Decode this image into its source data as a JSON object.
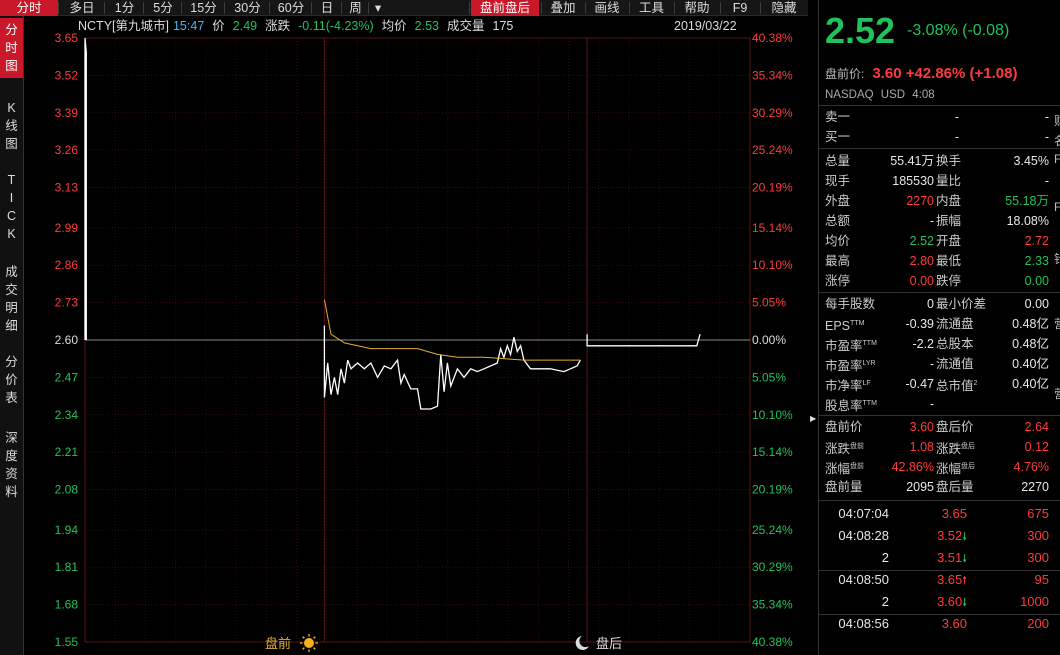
{
  "toolbar": {
    "tabs": [
      {
        "label": "分时",
        "active": true
      },
      {
        "label": "多日"
      },
      {
        "label": "1分"
      },
      {
        "label": "5分"
      },
      {
        "label": "15分"
      },
      {
        "label": "30分"
      },
      {
        "label": "60分"
      },
      {
        "label": "日"
      },
      {
        "label": "周"
      },
      {
        "label": "▾"
      }
    ],
    "right_tabs": [
      {
        "label": "盘前盘后",
        "active": true
      },
      {
        "label": "叠加"
      },
      {
        "label": "画线"
      },
      {
        "label": "工具"
      },
      {
        "label": "帮助"
      },
      {
        "label": "F9"
      },
      {
        "label": "隐藏"
      }
    ]
  },
  "left_tabs": [
    {
      "label": "分时图",
      "active": true
    },
    {
      "label": "K线图"
    },
    {
      "label": "TICK"
    },
    {
      "label": "成交明细"
    },
    {
      "label": "分价表"
    },
    {
      "label": "深度资料"
    }
  ],
  "header": {
    "symbol": "NCTY[第九城市]",
    "time": "15:47",
    "price_label": "价",
    "price": "2.49",
    "change_label": "涨跌",
    "change": "-0.11(-4.23%)",
    "avg_label": "均价",
    "avg": "2.53",
    "volume_label": "成交量",
    "volume": "175",
    "date": "2019/03/22"
  },
  "chart_data": {
    "type": "line",
    "y_left_ticks": [
      "3.65",
      "3.52",
      "3.39",
      "3.26",
      "3.13",
      "2.99",
      "2.86",
      "2.73",
      "2.60",
      "2.47",
      "2.34",
      "2.21",
      "2.08",
      "1.94",
      "1.81",
      "1.68",
      "1.55"
    ],
    "y_right_ticks": [
      "40.38%",
      "35.34%",
      "30.29%",
      "25.24%",
      "20.19%",
      "15.14%",
      "10.10%",
      "5.05%",
      "0.00%",
      "5.05%",
      "10.10%",
      "15.14%",
      "20.19%",
      "25.24%",
      "30.29%",
      "35.34%",
      "40.38%"
    ],
    "prev_close": 2.6,
    "ylim": [
      1.55,
      3.65
    ],
    "x_range": [
      0,
      1
    ],
    "session_labels": {
      "pre": "盘前",
      "post": "盘后"
    },
    "price_series": [
      [
        0.0,
        2.6
      ],
      [
        0.0,
        3.65
      ],
      [
        0.002,
        3.6
      ],
      [
        0.002,
        2.6
      ],
      [
        0.36,
        2.65
      ],
      [
        0.36,
        2.4
      ],
      [
        0.365,
        2.52
      ],
      [
        0.37,
        2.41
      ],
      [
        0.375,
        2.47
      ],
      [
        0.38,
        2.41
      ],
      [
        0.385,
        2.5
      ],
      [
        0.39,
        2.45
      ],
      [
        0.395,
        2.53
      ],
      [
        0.4,
        2.5
      ],
      [
        0.41,
        2.52
      ],
      [
        0.42,
        2.5
      ],
      [
        0.43,
        2.52
      ],
      [
        0.44,
        2.47
      ],
      [
        0.45,
        2.51
      ],
      [
        0.46,
        2.5
      ],
      [
        0.47,
        2.53
      ],
      [
        0.475,
        2.45
      ],
      [
        0.48,
        2.48
      ],
      [
        0.49,
        2.43
      ],
      [
        0.5,
        2.43
      ],
      [
        0.505,
        2.36
      ],
      [
        0.52,
        2.36
      ],
      [
        0.53,
        2.37
      ],
      [
        0.535,
        2.55
      ],
      [
        0.54,
        2.42
      ],
      [
        0.545,
        2.52
      ],
      [
        0.55,
        2.44
      ],
      [
        0.56,
        2.5
      ],
      [
        0.57,
        2.47
      ],
      [
        0.58,
        2.5
      ],
      [
        0.59,
        2.49
      ],
      [
        0.6,
        2.5
      ],
      [
        0.61,
        2.51
      ],
      [
        0.62,
        2.52
      ],
      [
        0.625,
        2.57
      ],
      [
        0.63,
        2.54
      ],
      [
        0.635,
        2.58
      ],
      [
        0.64,
        2.55
      ],
      [
        0.645,
        2.61
      ],
      [
        0.65,
        2.56
      ],
      [
        0.655,
        2.58
      ],
      [
        0.66,
        2.53
      ],
      [
        0.67,
        2.5
      ],
      [
        0.7,
        2.5
      ],
      [
        0.72,
        2.49
      ],
      [
        0.73,
        2.5
      ],
      [
        0.74,
        2.51
      ],
      [
        0.745,
        2.53
      ],
      [
        0.755,
        2.62
      ],
      [
        0.755,
        2.58
      ],
      [
        0.92,
        2.58
      ],
      [
        0.925,
        2.62
      ]
    ],
    "avg_series": [
      [
        0.36,
        2.74
      ],
      [
        0.37,
        2.62
      ],
      [
        0.39,
        2.59
      ],
      [
        0.43,
        2.57
      ],
      [
        0.5,
        2.57
      ],
      [
        0.53,
        2.55
      ],
      [
        0.56,
        2.54
      ],
      [
        0.6,
        2.54
      ],
      [
        0.66,
        2.53
      ],
      [
        0.7,
        2.53
      ],
      [
        0.745,
        2.53
      ]
    ]
  },
  "quote": {
    "price": "2.52",
    "change": "-3.08% (-0.08)",
    "pre_label": "盘前价:",
    "pre_value": "3.60 +42.86% (+1.08)",
    "exchange": "NASDAQ",
    "currency": "USD",
    "time": "4:08",
    "bidask": [
      {
        "label": "卖一",
        "v1": "-",
        "v2": "-"
      },
      {
        "label": "买一",
        "v1": "-",
        "v2": "-"
      }
    ],
    "stats": [
      {
        "l1": "总量",
        "v1": "55.41万",
        "c1": "w",
        "l2": "换手",
        "v2": "3.45%",
        "c2": "w"
      },
      {
        "l1": "现手",
        "v1": "185530",
        "c1": "w",
        "l2": "量比",
        "v2": "-",
        "c2": "w"
      },
      {
        "l1": "外盘",
        "v1": "2270",
        "c1": "r",
        "l2": "内盘",
        "v2": "55.18万",
        "c2": "g"
      },
      {
        "l1": "总额",
        "v1": "-",
        "c1": "w",
        "l2": "振幅",
        "v2": "18.08%",
        "c2": "w"
      },
      {
        "l1": "均价",
        "v1": "2.52",
        "c1": "g",
        "l2": "开盘",
        "v2": "2.72",
        "c2": "r"
      },
      {
        "l1": "最高",
        "v1": "2.80",
        "c1": "r",
        "l2": "最低",
        "v2": "2.33",
        "c2": "g"
      },
      {
        "l1": "涨停",
        "v1": "0.00",
        "c1": "r",
        "l2": "跌停",
        "v2": "0.00",
        "c2": "g"
      }
    ],
    "fundamentals": [
      {
        "l1": "每手股数",
        "v1": "0",
        "l2": "最小价差",
        "v2": "0.00"
      },
      {
        "l1": "EPS",
        "s1": "TTM",
        "v1": "-0.39",
        "l2": "流通盘",
        "v2": "0.48亿"
      },
      {
        "l1": "市盈率",
        "s1": "TTM",
        "v1": "-2.2",
        "l2": "总股本",
        "v2": "0.48亿"
      },
      {
        "l1": "市盈率",
        "s1": "LYR",
        "v1": "-",
        "l2": "流通值",
        "v2": "0.40亿"
      },
      {
        "l1": "市净率",
        "s1": "LF",
        "v1": "-0.47",
        "l2": "总市值",
        "s2": "2",
        "v2": "0.40亿"
      },
      {
        "l1": "股息率",
        "s1": "TTM",
        "v1": "-",
        "l2": "",
        "v2": ""
      }
    ],
    "extended": [
      {
        "l1": "盘前价",
        "v1": "3.60",
        "c1": "r",
        "l2": "盘后价",
        "v2": "2.64",
        "c2": "r"
      },
      {
        "l1": "涨跌",
        "s1": "盘前",
        "v1": "1.08",
        "c1": "r",
        "l2": "涨跌",
        "s2": "盘后",
        "v2": "0.12",
        "c2": "r"
      },
      {
        "l1": "涨幅",
        "s1": "盘前",
        "v1": "42.86%",
        "c1": "r",
        "l2": "涨幅",
        "s2": "盘后",
        "v2": "4.76%",
        "c2": "r"
      },
      {
        "l1": "盘前量",
        "v1": "2095",
        "c1": "w",
        "l2": "盘后量",
        "v2": "2270",
        "c2": "w"
      }
    ],
    "ticks": [
      {
        "time": "04:07:04",
        "price": "3.65",
        "arrow": "",
        "vol": "675"
      },
      {
        "time": "04:08:28",
        "price": "3.52",
        "arrow": "down",
        "vol": "300"
      },
      {
        "time": "2",
        "price": "3.51",
        "arrow": "down",
        "vol": "300"
      },
      {
        "time": "04:08:50",
        "price": "3.65",
        "arrow": "up",
        "vol": "95"
      },
      {
        "time": "2",
        "price": "3.60",
        "arrow": "down",
        "vol": "1000"
      },
      {
        "time": "04:08:56",
        "price": "3.60",
        "arrow": "",
        "vol": "200"
      }
    ]
  },
  "colors": {
    "up": "#ff3b3b",
    "down": "#1fc35a",
    "avg_line": "#e0b030",
    "grid": "#3a0d0d",
    "accent": "#c8182a"
  }
}
